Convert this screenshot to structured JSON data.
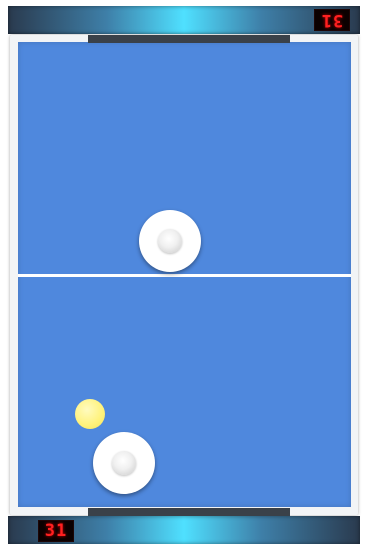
{
  "scoreboard": {
    "top_score": "31",
    "bottom_score": "31"
  },
  "colors": {
    "field": "#4f88dd",
    "puck": "#fff27a",
    "score_digits": "#ff2020",
    "center_line": "#ffffff"
  }
}
